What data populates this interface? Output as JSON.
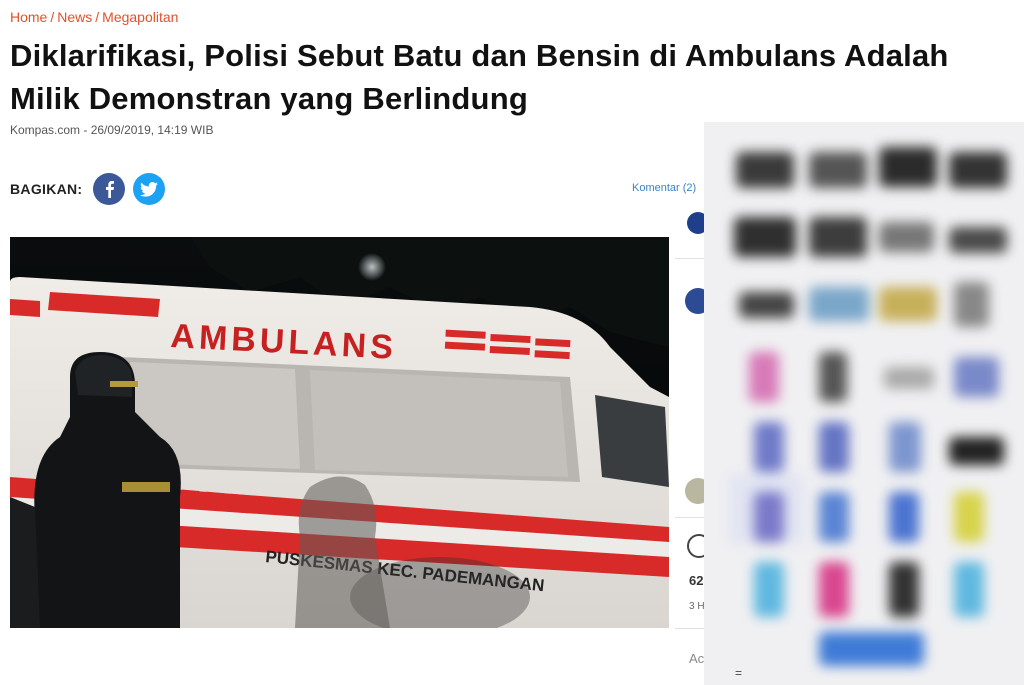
{
  "breadcrumb": {
    "home": "Home",
    "news": "News",
    "category": "Megapolitan",
    "separator": "/"
  },
  "article": {
    "title": "Diklarifikasi, Polisi Sebut Batu dan Bensin di Ambulans Adalah Milik Demonstran yang Berlindung",
    "source": "Kompas.com",
    "date": "26/09/2019, 14:19 WIB",
    "meta_separator": " - "
  },
  "share": {
    "label": "BAGIKAN:",
    "facebook_icon": "facebook-icon",
    "twitter_icon": "twitter-icon"
  },
  "comments": {
    "label": "Komentar (2)"
  },
  "video": {
    "vehicle_text": "AMBULANS",
    "side_text": "PUSKESMAS KEC. PADEMANGAN",
    "colors": {
      "body": "#e9e6e2",
      "stripe": "#d92a2a",
      "sky": "#050708"
    }
  },
  "sidebar": {
    "count": "62",
    "time": "3 H",
    "action": "Ac"
  },
  "ad_panel": {
    "symbol": "="
  },
  "colors": {
    "accent": "#e4502a",
    "facebook": "#3b5998",
    "twitter": "#1da1f2",
    "link": "#3a84c6"
  }
}
